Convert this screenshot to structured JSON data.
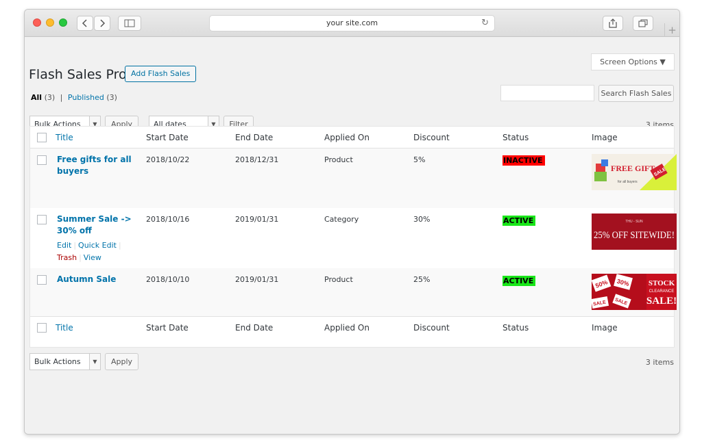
{
  "browser": {
    "url": "your site.com"
  },
  "page": {
    "screen_options": "Screen Options ▼",
    "title": "Flash Sales Pro",
    "add_button": "Add Flash Sales",
    "filters": {
      "all_label": "All",
      "all_count": "(3)",
      "separator": "|",
      "published_label": "Published",
      "published_count": "(3)"
    },
    "search_button": "Search Flash Sales",
    "search_value": "",
    "bulk_actions": "Bulk Actions",
    "apply": "Apply",
    "all_dates": "All dates",
    "filter": "Filter",
    "items_count": "3 items"
  },
  "table": {
    "columns": [
      "Title",
      "Start Date",
      "End Date",
      "Applied On",
      "Discount",
      "Status",
      "Image"
    ],
    "rows": [
      {
        "title": "Free gifts for all buyers",
        "start": "2018/10/22",
        "end": "2018/12/31",
        "applied_on": "Product",
        "discount": "5%",
        "status": "INACTIVE",
        "image_text": "FREE GIFT",
        "image_sub": "for all buyers",
        "image_tag": "SALE"
      },
      {
        "title": "Summer Sale -> 30% off",
        "start": "2018/10/16",
        "end": "2019/01/31",
        "applied_on": "Category",
        "discount": "30%",
        "status": "ACTIVE",
        "image_sub": "THU - SUN",
        "image_text": "25% OFF SITEWIDE!",
        "actions": {
          "edit": "Edit",
          "quick_edit": "Quick Edit",
          "trash": "Trash",
          "view": "View",
          "sep": "|"
        }
      },
      {
        "title": "Autumn Sale",
        "start": "2018/10/10",
        "end": "2019/01/31",
        "applied_on": "Product",
        "discount": "25%",
        "status": "ACTIVE",
        "image_tags": [
          "50%",
          "30%",
          "SALE",
          "SALE"
        ],
        "image_line1": "STOCK",
        "image_line2": "CLEARANCE",
        "image_line3": "SALE!"
      }
    ]
  },
  "colors": {
    "link": "#0073aa",
    "inactive": "#ff0000",
    "active": "#19e619"
  }
}
